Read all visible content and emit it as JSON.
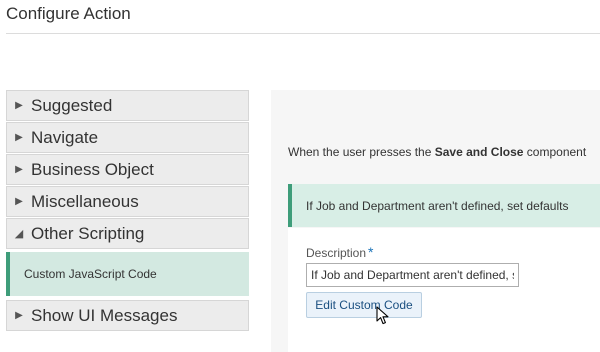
{
  "header": {
    "title": "Configure Action"
  },
  "sidebar": {
    "items": [
      {
        "label": "Suggested",
        "arrow": "▶"
      },
      {
        "label": "Navigate",
        "arrow": "▶"
      },
      {
        "label": "Business Object",
        "arrow": "▶"
      },
      {
        "label": "Miscellaneous",
        "arrow": "▶"
      },
      {
        "label": "Other Scripting",
        "arrow": "◢"
      }
    ],
    "sub_item": {
      "label": "Custom JavaScript Code"
    },
    "after": {
      "label": "Show UI Messages",
      "arrow": "▶"
    }
  },
  "main": {
    "instruction_pre": "When the user presses the ",
    "instruction_bold": "Save and Close",
    "instruction_post": " component",
    "banner_text": "If Job and Department aren't defined, set defaults",
    "description_label": "Description",
    "required_marker": "*",
    "description_value": "If Job and Department aren't defined, s",
    "edit_button": "Edit Custom Code"
  },
  "colors": {
    "accent": "#3e9d7a",
    "highlight": "#d3e9e1",
    "link": "#1a73b8"
  },
  "icons": {
    "cursor": "pointer-cursor-icon",
    "expand": "triangle-right-icon",
    "collapse": "triangle-down-icon"
  }
}
